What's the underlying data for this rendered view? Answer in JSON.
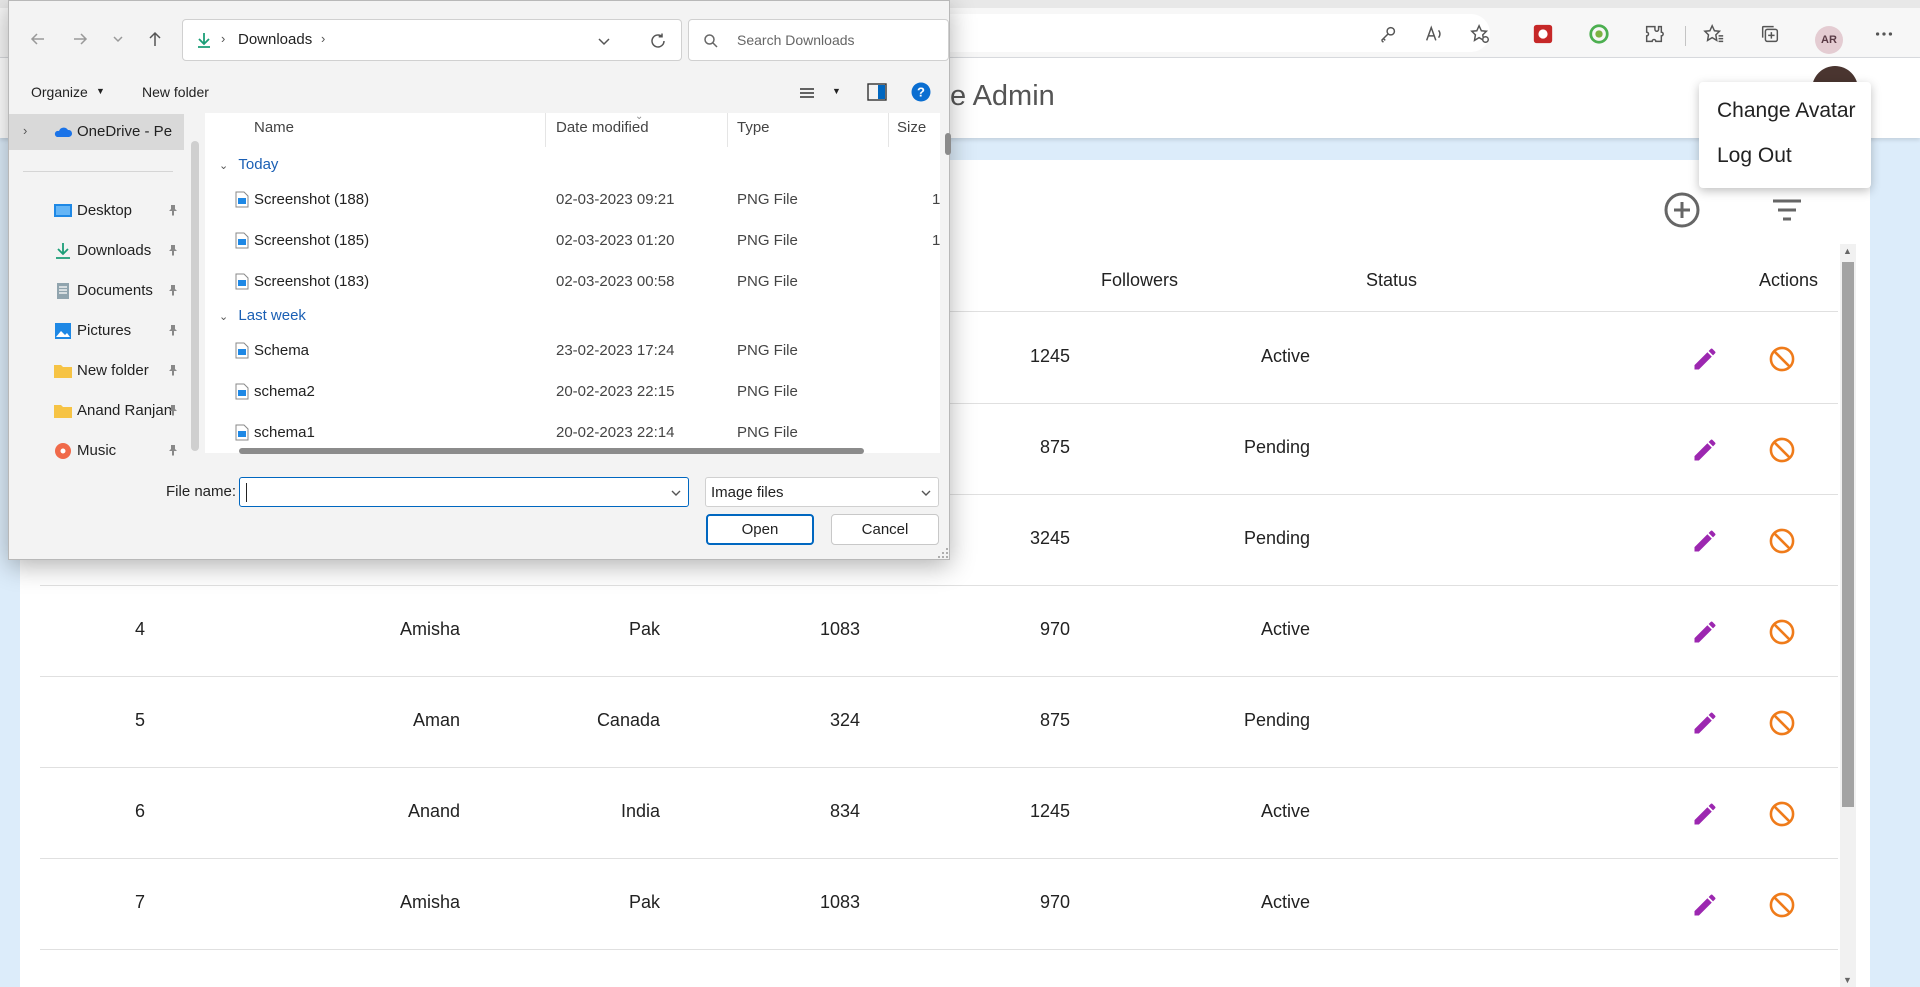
{
  "dialog": {
    "breadcrumb": "Downloads",
    "search_placeholder": "Search Downloads",
    "organize_label": "Organize",
    "new_folder_label": "New folder",
    "nav_items": [
      {
        "label": "OneDrive - Perso",
        "icon": "cloud-icon"
      },
      {
        "label": "Desktop",
        "icon": "desktop-icon"
      },
      {
        "label": "Downloads",
        "icon": "download-icon"
      },
      {
        "label": "Documents",
        "icon": "document-icon"
      },
      {
        "label": "Pictures",
        "icon": "picture-icon"
      },
      {
        "label": "New folder",
        "icon": "folder-icon"
      },
      {
        "label": "Anand Ranjan",
        "icon": "folder-icon"
      },
      {
        "label": "Music",
        "icon": "music-icon"
      }
    ],
    "columns": [
      "Name",
      "Date modified",
      "Type",
      "Size"
    ],
    "groups": [
      "Today",
      "Last week"
    ],
    "files_today": [
      {
        "name": "Screenshot (188)",
        "date": "02-03-2023 09:21",
        "type": "PNG File",
        "size": "1"
      },
      {
        "name": "Screenshot (185)",
        "date": "02-03-2023 01:20",
        "type": "PNG File",
        "size": "1"
      },
      {
        "name": "Screenshot (183)",
        "date": "02-03-2023 00:58",
        "type": "PNG File",
        "size": ""
      }
    ],
    "files_last_week": [
      {
        "name": "Schema",
        "date": "23-02-2023 17:24",
        "type": "PNG File",
        "size": ""
      },
      {
        "name": "schema2",
        "date": "20-02-2023 22:15",
        "type": "PNG File",
        "size": ""
      },
      {
        "name": "schema1",
        "date": "20-02-2023 22:14",
        "type": "PNG File",
        "size": ""
      }
    ],
    "file_name_label": "File name:",
    "file_name_value": "",
    "file_type_value": "Image files",
    "open_label": "Open",
    "cancel_label": "Cancel"
  },
  "app": {
    "title_fragment": "e Admin",
    "menu": [
      "Change Avatar",
      "Log Out"
    ],
    "columns": [
      "Followers",
      "Status",
      "Actions"
    ],
    "rows": [
      {
        "id": "",
        "name": "",
        "country": "",
        "posts": "",
        "followers": "1245",
        "status": "Active"
      },
      {
        "id": "",
        "name": "",
        "country": "",
        "posts": "",
        "followers": "875",
        "status": "Pending"
      },
      {
        "id": "",
        "name": "",
        "country": "",
        "posts": "",
        "followers": "3245",
        "status": "Pending"
      },
      {
        "id": "4",
        "name": "Amisha",
        "country": "Pak",
        "posts": "1083",
        "followers": "970",
        "status": "Active"
      },
      {
        "id": "5",
        "name": "Aman",
        "country": "Canada",
        "posts": "324",
        "followers": "875",
        "status": "Pending"
      },
      {
        "id": "6",
        "name": "Anand",
        "country": "India",
        "posts": "834",
        "followers": "1245",
        "status": "Active"
      },
      {
        "id": "7",
        "name": "Amisha",
        "country": "Pak",
        "posts": "1083",
        "followers": "970",
        "status": "Active"
      }
    ]
  },
  "browser": {
    "profile_initials": "AR"
  },
  "colors": {
    "edit": "#9c27b0",
    "block": "#ef7b1a",
    "accent": "#0067c0"
  }
}
